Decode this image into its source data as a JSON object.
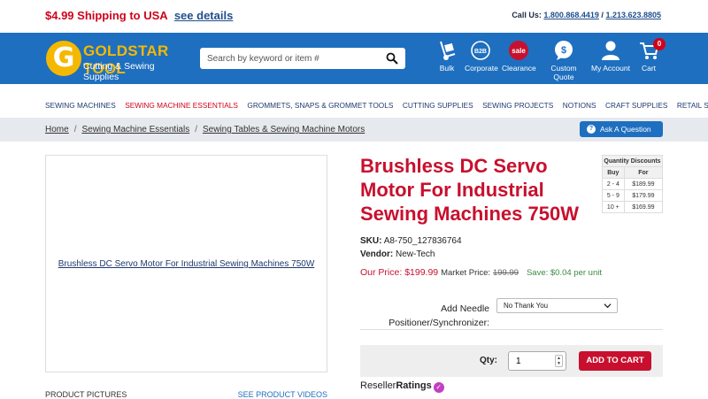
{
  "promo": {
    "text": "$4.99 Shipping to USA",
    "link": "see details"
  },
  "contact": {
    "label": "Call Us:",
    "phone1": "1.800.868.4419",
    "phone2": "1.213.623.8805"
  },
  "logo": {
    "letter": "G",
    "title": "GOLDSTAR TOOL",
    "subtitle": "Cutting & Sewing Supplies"
  },
  "search": {
    "placeholder": "Search by keyword or item #"
  },
  "nav_icons": [
    {
      "label": "Bulk",
      "icon": "hand-truck-icon"
    },
    {
      "label": "Corporate",
      "icon": "b2b-icon",
      "text": "B2B"
    },
    {
      "label": "Clearance",
      "icon": "sale-icon",
      "text": "sale"
    },
    {
      "label": "Custom Quote",
      "icon": "dollar-chat-icon",
      "text": "$"
    },
    {
      "label": "My Account",
      "icon": "user-icon"
    },
    {
      "label": "Cart",
      "icon": "cart-icon",
      "count": "0"
    }
  ],
  "categories": [
    "SEWING MACHINES",
    "SEWING MACHINE ESSENTIALS",
    "GROMMETS, SNAPS & GROMMET TOOLS",
    "CUTTING SUPPLIES",
    "SEWING PROJECTS",
    "NOTIONS",
    "CRAFT SUPPLIES",
    "RETAIL SUPPLIES"
  ],
  "breadcrumb": [
    "Home",
    "Sewing Machine Essentials",
    "Sewing Tables & Sewing Machine Motors"
  ],
  "ask_button": "Ask A Question",
  "product": {
    "image_alt": "Brushless DC Servo Motor For Industrial Sewing Machines 750W",
    "title": "Brushless DC Servo Motor For Industrial Sewing Machines 750W",
    "sku_label": "SKU:",
    "sku": "A8-750_127836764",
    "vendor_label": "Vendor:",
    "vendor": "New-Tech",
    "our_price_label": "Our Price:",
    "our_price": "$199.99",
    "market_price_label": "Market Price:",
    "market_price": "199.99",
    "save_text": "Save: $0.04 per unit"
  },
  "quantity_discounts": {
    "header": "Quantity Discounts",
    "col_buy": "Buy",
    "col_for": "For",
    "rows": [
      {
        "buy": "2 - 4",
        "for": "$189.99"
      },
      {
        "buy": "5 - 9",
        "for": "$179.99"
      },
      {
        "buy": "10 +",
        "for": "$169.99"
      }
    ]
  },
  "option": {
    "label": "Add Needle Positioner/Synchronizer:",
    "value": "No Thank You"
  },
  "cart": {
    "qty_label": "Qty:",
    "qty_value": "1",
    "add_button": "ADD TO CART"
  },
  "reseller": {
    "prefix": "Reseller",
    "bold": "Ratings"
  },
  "picture_tabs": {
    "left": "PRODUCT PICTURES",
    "right": "SEE PRODUCT VIDEOS"
  },
  "colors": {
    "brand_blue": "#1e6fbf",
    "brand_red": "#c8102e",
    "logo_gold": "#f5b800"
  }
}
